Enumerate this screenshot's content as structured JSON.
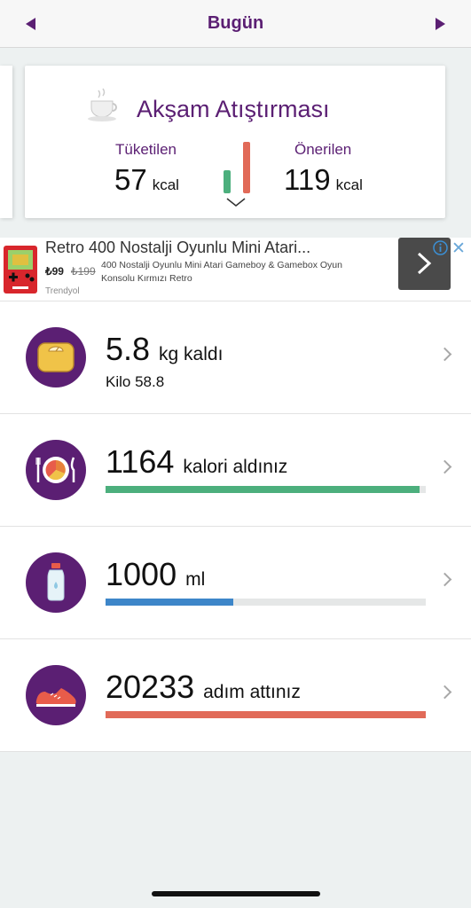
{
  "header": {
    "title": "Bugün"
  },
  "meal": {
    "title": "Akşam Atıştırması",
    "consumed_label": "Tüketilen",
    "consumed_value": "57",
    "consumed_unit": "kcal",
    "recommended_label": "Önerilen",
    "recommended_value": "119",
    "recommended_unit": "kcal"
  },
  "ad": {
    "title": "Retro 400 Nostalji Oyunlu Mini Atari...",
    "price": "₺99",
    "old_price": "₺199",
    "description": "400 Nostalji Oyunlu Mini Atari Gameboy & Gamebox Oyun Konsolu Kırmızı Retro",
    "brand": "Trendyol",
    "close": "✕"
  },
  "rows": [
    {
      "value": "5.8",
      "unit": "kg kaldı",
      "sub": "Kilo 58.8",
      "icon": "scale-icon"
    },
    {
      "value": "1164",
      "unit": "kalori aldınız",
      "progress": 0.98,
      "color": "#4caf7d",
      "icon": "plate-icon"
    },
    {
      "value": "1000",
      "unit": "ml",
      "progress": 0.4,
      "color": "#3d86c9",
      "icon": "water-bottle-icon"
    },
    {
      "value": "20233",
      "unit": "adım attınız",
      "progress": 1.0,
      "color": "#e16a58",
      "icon": "sneaker-icon"
    }
  ],
  "colors": {
    "accent": "#5b1f73",
    "green": "#4caf7d",
    "red": "#e16a58",
    "blue": "#3d86c9"
  }
}
